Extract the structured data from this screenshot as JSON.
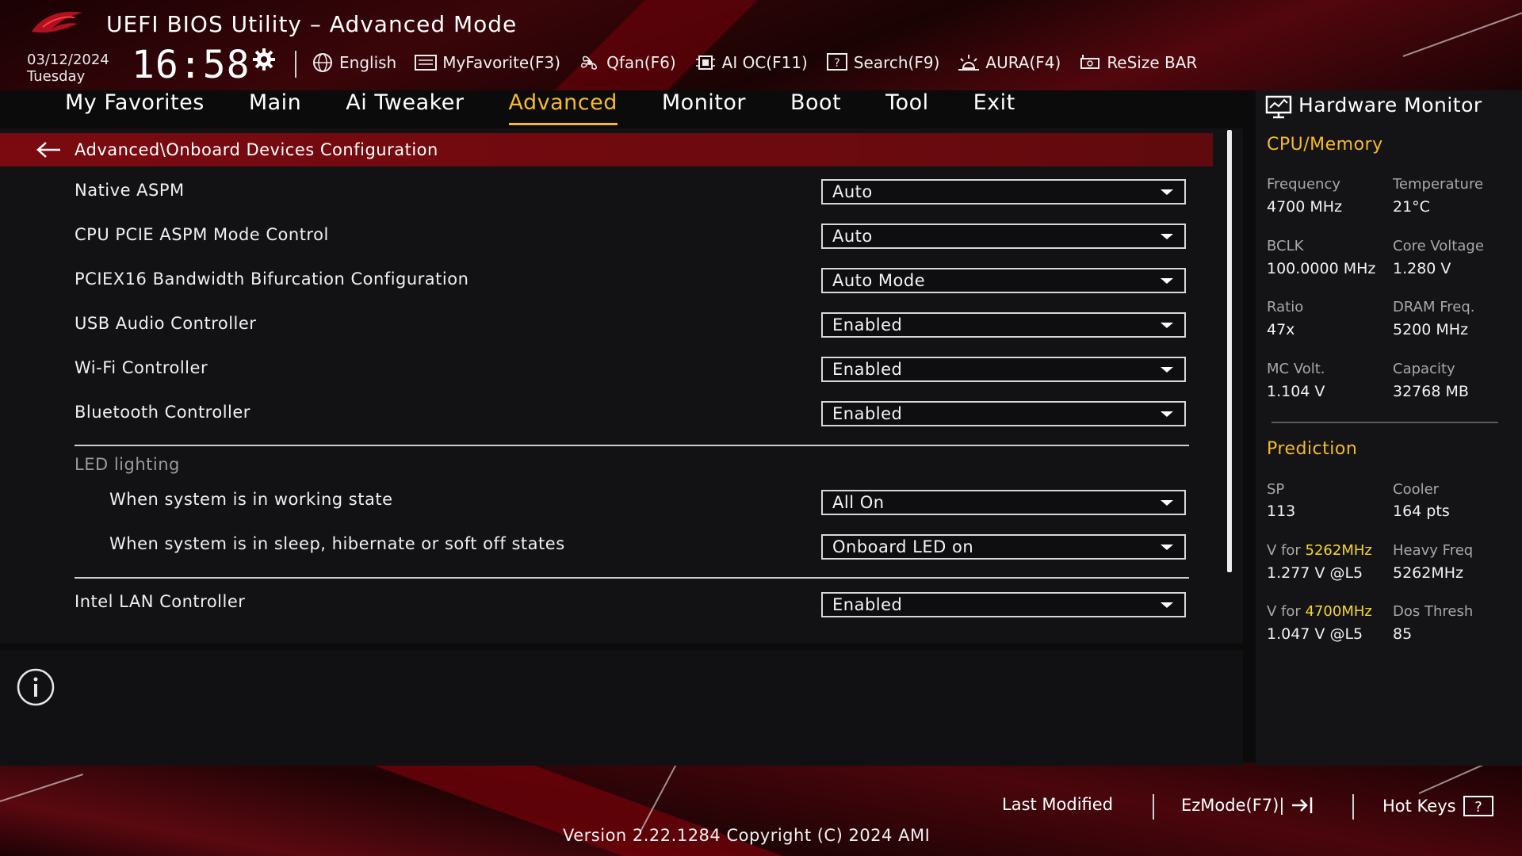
{
  "header": {
    "app_title": "UEFI BIOS Utility – Advanced Mode",
    "date": "03/12/2024",
    "weekday": "Tuesday",
    "time": "16:58"
  },
  "toolbar": {
    "language": "English",
    "myfavorite": "MyFavorite(F3)",
    "qfan": "Qfan(F6)",
    "aioc": "AI OC(F11)",
    "search": "Search(F9)",
    "aura": "AURA(F4)",
    "resizebar": "ReSize BAR"
  },
  "nav": {
    "tabs": [
      {
        "label": "My Favorites"
      },
      {
        "label": "Main"
      },
      {
        "label": "Ai Tweaker"
      },
      {
        "label": "Advanced"
      },
      {
        "label": "Monitor"
      },
      {
        "label": "Boot"
      },
      {
        "label": "Tool"
      },
      {
        "label": "Exit"
      }
    ],
    "active": "Advanced"
  },
  "breadcrumb": "Advanced\\Onboard Devices Configuration",
  "settings": [
    {
      "label": "Native ASPM",
      "value": "Auto"
    },
    {
      "label": "CPU PCIE ASPM Mode Control",
      "value": "Auto"
    },
    {
      "label": "PCIEX16 Bandwidth Bifurcation Configuration",
      "value": "Auto Mode"
    },
    {
      "label": "USB Audio Controller",
      "value": "Enabled"
    },
    {
      "label": "Wi-Fi Controller",
      "value": "Enabled"
    },
    {
      "label": "Bluetooth Controller",
      "value": "Enabled"
    },
    {
      "label": "When system is in working state",
      "value": "All On"
    },
    {
      "label": "When system is in sleep, hibernate or soft off states",
      "value": "Onboard LED on"
    },
    {
      "label": "Intel LAN Controller",
      "value": "Enabled"
    }
  ],
  "led_section_label": "LED lighting",
  "hardware_monitor": {
    "title": "Hardware Monitor",
    "cpu_memory_title": "CPU/Memory",
    "frequency_label": "Frequency",
    "frequency_value": "4700 MHz",
    "temperature_label": "Temperature",
    "temperature_value": "21°C",
    "bclk_label": "BCLK",
    "bclk_value": "100.0000 MHz",
    "core_voltage_label": "Core Voltage",
    "core_voltage_value": "1.280 V",
    "ratio_label": "Ratio",
    "ratio_value": "47x",
    "dram_freq_label": "DRAM Freq.",
    "dram_freq_value": "5200 MHz",
    "mc_volt_label": "MC Volt.",
    "mc_volt_value": "1.104 V",
    "capacity_label": "Capacity",
    "capacity_value": "32768 MB",
    "prediction_title": "Prediction",
    "sp_label": "SP",
    "sp_value": "113",
    "cooler_label": "Cooler",
    "cooler_value": "164 pts",
    "v_for_prefix": "V for ",
    "v_for_1_freq": "5262MHz",
    "v_for_1_value": "1.277 V @L5",
    "heavy_freq_label": "Heavy Freq",
    "heavy_freq_value": "5262MHz",
    "v_for_2_freq": "4700MHz",
    "v_for_2_value": "1.047 V @L5",
    "dos_thresh_label": "Dos Thresh",
    "dos_thresh_value": "85"
  },
  "footer": {
    "last_modified": "Last Modified",
    "ezmode": "EzMode(F7)|",
    "hotkeys": "Hot Keys",
    "version": "Version 2.22.1284 Copyright (C) 2024 AMI"
  },
  "colors": {
    "accent": "#f7b928",
    "highlight": "#f7d528",
    "breadcrumb_bg": "#7a0a10"
  },
  "icons": {
    "logo": "rog-logo",
    "gear": "gear-icon",
    "language": "globe-icon",
    "myfavorite": "keyboard-icon",
    "qfan": "fan-icon",
    "aioc": "chip-icon",
    "search": "help-box-icon",
    "aura": "sun-icon",
    "resizebar": "gpu-icon",
    "back": "arrow-left-icon",
    "info": "info-circle-icon",
    "monitor": "monitor-icon",
    "ezmode": "exit-arrow-icon",
    "hotkeys": "question-box-icon"
  }
}
